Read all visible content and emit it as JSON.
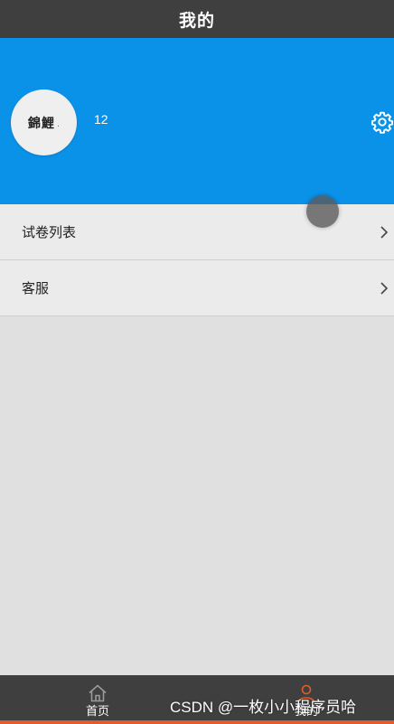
{
  "header": {
    "title": "我的"
  },
  "profile": {
    "avatar_text": "錦鯉",
    "username": "12",
    "settings_icon": "gear-icon",
    "header_color": "#0a91e8"
  },
  "menu": {
    "items": [
      {
        "label": "试卷列表",
        "icon": "chevron-right-icon"
      },
      {
        "label": "客服",
        "icon": "chevron-right-icon"
      }
    ]
  },
  "tabbar": {
    "tabs": [
      {
        "label": "首页",
        "icon": "home-icon",
        "active": false
      },
      {
        "label": "我的",
        "icon": "user-icon",
        "active": true
      }
    ],
    "active_color": "#e35b2c"
  },
  "watermark": {
    "text": "CSDN @一枚小小程序员哈"
  }
}
